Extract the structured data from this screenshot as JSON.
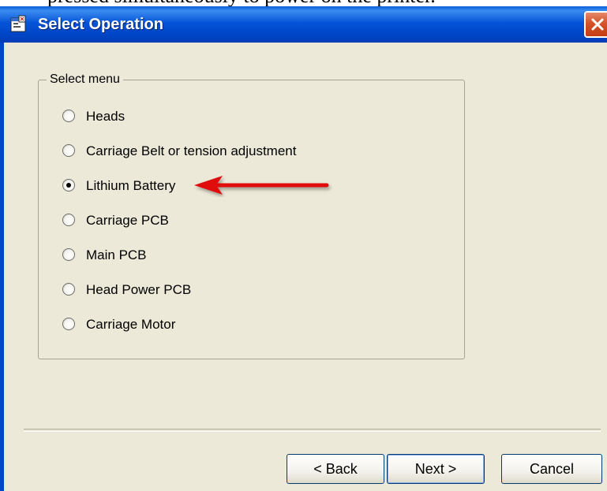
{
  "cropped_text": "pressed simultaneously to power on the printer.",
  "window": {
    "title": "Select Operation",
    "close_icon": "close-icon"
  },
  "group": {
    "label": "Select menu",
    "options": [
      {
        "label": "Heads",
        "selected": false
      },
      {
        "label": "Carriage Belt or tension adjustment",
        "selected": false
      },
      {
        "label": "Lithium Battery",
        "selected": true
      },
      {
        "label": "Carriage PCB",
        "selected": false
      },
      {
        "label": "Main PCB",
        "selected": false
      },
      {
        "label": "Head Power PCB",
        "selected": false
      },
      {
        "label": "Carriage Motor",
        "selected": false
      }
    ]
  },
  "annotation": {
    "arrow_icon": "red-arrow-icon",
    "arrow_color": "#e01010"
  },
  "buttons": {
    "back": "< Back",
    "next": "Next >",
    "cancel": "Cancel"
  }
}
